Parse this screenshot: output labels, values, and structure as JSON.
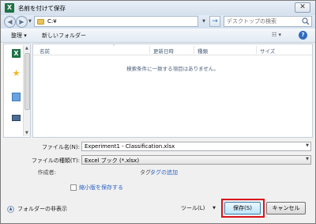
{
  "window": {
    "title": "名前を付けて保存",
    "close_symbol": "✕"
  },
  "address_bar": {
    "path": "C:¥",
    "search_placeholder": "デスクトップの検索",
    "refresh_symbol": "→"
  },
  "toolbar": {
    "organize": "整理 ▾",
    "new_folder": "新しいフォルダー",
    "view_symbol": "☷ ▾",
    "help_symbol": "?"
  },
  "file_list": {
    "columns": [
      "名前",
      "更新日時",
      "種類",
      "サイズ"
    ],
    "empty_message": "検索条件に一致する項目はありません。"
  },
  "form": {
    "filename_label": "ファイル名(N):",
    "filename_value": "Experiment1 - Classification.xlsx",
    "filetype_label": "ファイルの種類(T):",
    "filetype_value": "Excel ブック (*.xlsx)",
    "author_label": "作成者:",
    "tag_label": "タグ:",
    "tag_link": "タグの追加",
    "thumbnail_label": "縮小版を保存する"
  },
  "footer": {
    "hide_folders": "フォルダーの非表示",
    "tools": "ツール(L)",
    "save": "保存(S)",
    "cancel": "キャンセル"
  },
  "colors": {
    "highlight": "#d8141b",
    "link": "#2a63c6",
    "excel_green": "#1d7244"
  },
  "icons": [
    "excel-icon",
    "back-icon",
    "forward-icon",
    "folder-icon",
    "refresh-icon",
    "search-icon",
    "help-icon",
    "star-icon",
    "library-icon",
    "computer-icon",
    "hide-folders-icon"
  ]
}
